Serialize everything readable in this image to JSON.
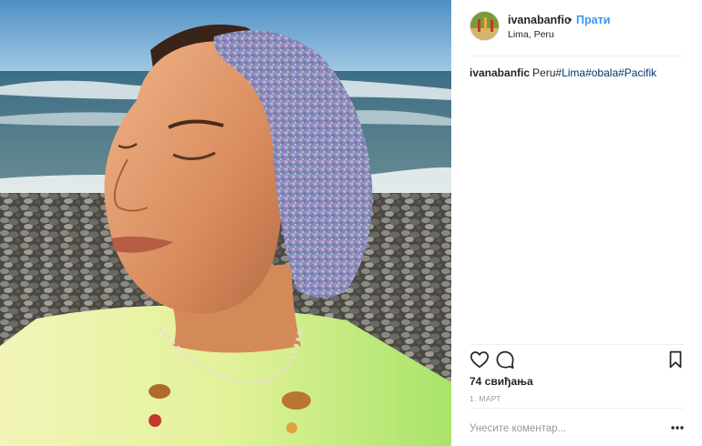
{
  "post": {
    "username": "ivanabanfic",
    "separator": "•",
    "follow_label": "Прати",
    "location": "Lima, Peru",
    "caption": {
      "user": "ivanabanfic",
      "text": "Peru",
      "hashtags": [
        "#Lima",
        "#obala",
        "#Pacifik"
      ]
    },
    "likes": "74 свиђања",
    "date": "1. МАРТ",
    "comment_placeholder": "Унесите коментар..."
  },
  "icons": {
    "like": "heart-outline-icon",
    "comment": "speech-bubble-icon",
    "save": "bookmark-icon",
    "more": "ellipsis-icon"
  },
  "colors": {
    "link_blue": "#3897f0",
    "hashtag": "#003569",
    "muted": "#999999",
    "text": "#262626"
  }
}
